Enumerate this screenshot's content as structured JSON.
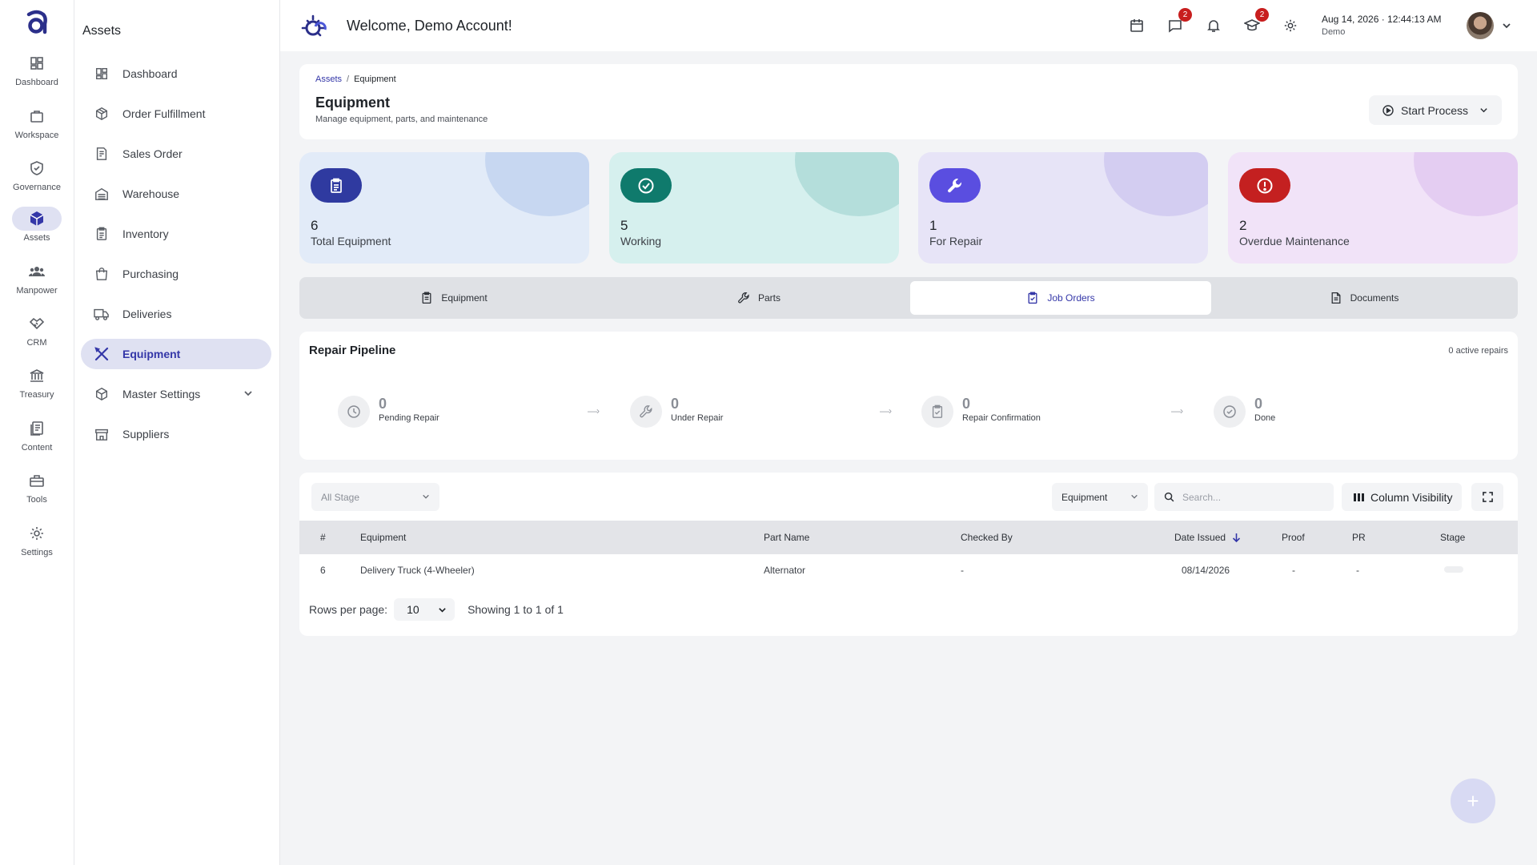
{
  "rail": {
    "items": [
      {
        "label": "Dashboard",
        "icon": "dashboard-icon"
      },
      {
        "label": "Workspace",
        "icon": "briefcase-icon"
      },
      {
        "label": "Governance",
        "icon": "shield-check-icon"
      },
      {
        "label": "Assets",
        "icon": "cube-icon",
        "active": true
      },
      {
        "label": "Manpower",
        "icon": "people-icon"
      },
      {
        "label": "CRM",
        "icon": "handshake-icon"
      },
      {
        "label": "Treasury",
        "icon": "bank-icon"
      },
      {
        "label": "Content",
        "icon": "document-icon"
      },
      {
        "label": "Tools",
        "icon": "toolbox-icon"
      },
      {
        "label": "Settings",
        "icon": "gear-icon"
      }
    ]
  },
  "sidebar": {
    "title": "Assets",
    "items": [
      {
        "label": "Dashboard",
        "icon": "dashboard-icon"
      },
      {
        "label": "Order Fulfillment",
        "icon": "package-icon"
      },
      {
        "label": "Sales Order",
        "icon": "invoice-icon"
      },
      {
        "label": "Warehouse",
        "icon": "warehouse-icon"
      },
      {
        "label": "Inventory",
        "icon": "clipboard-list-icon"
      },
      {
        "label": "Purchasing",
        "icon": "shopping-bag-icon"
      },
      {
        "label": "Deliveries",
        "icon": "truck-icon"
      },
      {
        "label": "Equipment",
        "icon": "tools-icon",
        "active": true
      },
      {
        "label": "Master Settings",
        "icon": "cube-outline-icon",
        "expandable": true
      },
      {
        "label": "Suppliers",
        "icon": "store-icon"
      }
    ]
  },
  "header": {
    "welcome": "Welcome, Demo Account!",
    "messages_badge": "2",
    "learning_badge": "2",
    "datetime": "Aug 14, 2026 · 12:44:13 AM",
    "user": "Demo"
  },
  "page": {
    "breadcrumb_root": "Assets",
    "breadcrumb_sep": "/",
    "breadcrumb_current": "Equipment",
    "title": "Equipment",
    "subtitle": "Manage equipment, parts, and maintenance",
    "start_process": "Start Process"
  },
  "stats": [
    {
      "value": "6",
      "label": "Total Equipment",
      "icon": "clipboard-icon",
      "bg": "#e2ebf8",
      "blob": "#c7d7f1",
      "icon_bg": "#2f3aa0"
    },
    {
      "value": "5",
      "label": "Working",
      "icon": "check-circle-icon",
      "bg": "#d6f0ee",
      "blob": "#b4dedb",
      "icon_bg": "#0f7a6c"
    },
    {
      "value": "1",
      "label": "For Repair",
      "icon": "wrench-icon",
      "bg": "#e7e4f7",
      "blob": "#d3cdf1",
      "icon_bg": "#5a4ee0"
    },
    {
      "value": "2",
      "label": "Overdue Maintenance",
      "icon": "alert-circle-icon",
      "bg": "#f1e3f8",
      "blob": "#e4cdf2",
      "icon_bg": "#c42020"
    }
  ],
  "tabs": [
    {
      "label": "Equipment",
      "icon": "clipboard-icon"
    },
    {
      "label": "Parts",
      "icon": "wrench-icon"
    },
    {
      "label": "Job Orders",
      "icon": "clipboard-check-icon",
      "active": true
    },
    {
      "label": "Documents",
      "icon": "file-icon"
    }
  ],
  "pipeline": {
    "title": "Repair Pipeline",
    "count": "0 active repairs",
    "arrow": "—›",
    "stages": [
      {
        "value": "0",
        "label": "Pending Repair",
        "icon": "clock-icon"
      },
      {
        "value": "0",
        "label": "Under Repair",
        "icon": "wrench-icon"
      },
      {
        "value": "0",
        "label": "Repair Confirmation",
        "icon": "clipboard-check-icon"
      },
      {
        "value": "0",
        "label": "Done",
        "icon": "check-circle-icon"
      }
    ]
  },
  "table": {
    "stage_filter": "All Stage",
    "type_filter": "Equipment",
    "search_placeholder": "Search...",
    "column_visibility": "Column Visibility",
    "columns": [
      "#",
      "Equipment",
      "Part Name",
      "Checked By",
      "Date Issued",
      "Proof",
      "PR",
      "Stage"
    ],
    "rows": [
      {
        "num": "6",
        "equipment": "Delivery Truck (4-Wheeler)",
        "part": "Alternator",
        "checked_by": "-",
        "date": "08/14/2026",
        "proof": "-",
        "pr": "-"
      }
    ],
    "rows_per_page_label": "Rows per page:",
    "rows_per_page": "10",
    "showing": "Showing 1 to 1 of 1"
  },
  "fab": "+"
}
